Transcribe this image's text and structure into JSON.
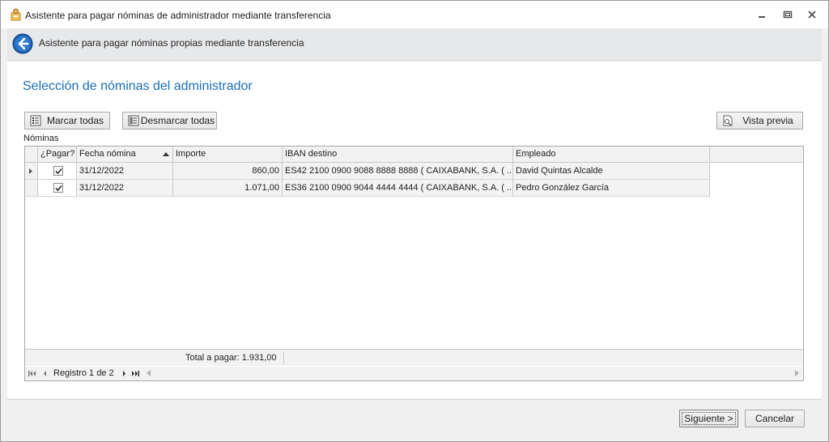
{
  "window": {
    "title": "Asistente para pagar nóminas de administrador mediante transferencia"
  },
  "header": {
    "title": "Asistente para pagar nóminas propias mediante transferencia"
  },
  "section": {
    "title": "Selección de nóminas del administrador"
  },
  "toolbar": {
    "marcar_label": "Marcar todas",
    "desmarcar_label": "Desmarcar todas",
    "vista_label": "Vista previa"
  },
  "grid": {
    "label": "Nóminas",
    "columns": [
      "¿Pagar?",
      "Fecha nómina",
      "Importe",
      "IBAN destino",
      "Empleado"
    ],
    "sorted_column": "Fecha nómina",
    "sort_direction": "ascending",
    "rows": [
      {
        "pagar": true,
        "fecha": "31/12/2022",
        "importe": "860,00",
        "iban": "ES42 2100 0900 9088 8888 8888 ( CAIXABANK, S.A. ( ...",
        "empleado": "David Quintas Alcalde"
      },
      {
        "pagar": true,
        "fecha": "31/12/2022",
        "importe": "1.071,00",
        "iban": "ES36 2100 0900 9044 4444 4444 ( CAIXABANK, S.A. ( ...",
        "empleado": "Pedro González García"
      }
    ],
    "total": "Total a pagar: 1.931,00",
    "record_text": "Registro 1 de 2"
  },
  "footer": {
    "next_label": "Siguiente >",
    "cancel_label": "Cancelar"
  },
  "colors": {
    "accent": "#1a6fb5",
    "border": "#a9a9a9",
    "header_bg": "#e7e8ea"
  }
}
